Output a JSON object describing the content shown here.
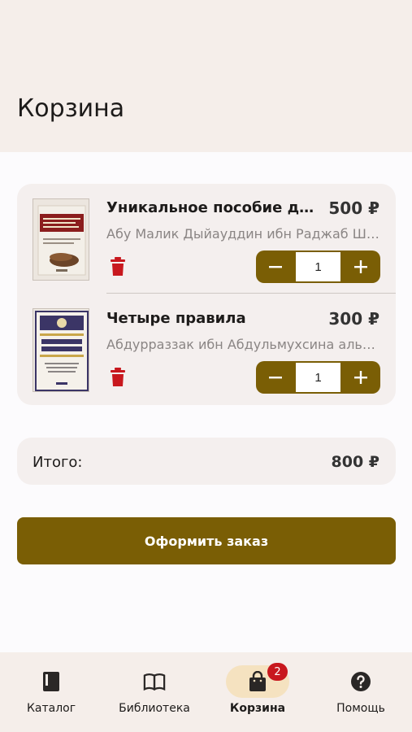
{
  "header": {
    "title": "Корзина"
  },
  "cart": {
    "items": [
      {
        "title": "Уникальное пособие для изучения Единобожия",
        "author": "Абу Малик Дыйауддин ибн Раджаб Шималов",
        "price": "500 ₽",
        "quantity": "1",
        "cover_color": "#5a3a2a"
      },
      {
        "title": "Четыре правила",
        "author": "Абдурраззак ибн Абдульмухсина аль-Бадр",
        "price": "300 ₽",
        "quantity": "1",
        "cover_color": "#3b3566"
      }
    ],
    "currency": "₽"
  },
  "total": {
    "label": "Итого:",
    "value": "800 ₽"
  },
  "checkout_label": "Оформить заказ",
  "nav": {
    "items": [
      {
        "label": "Каталог",
        "icon": "book-icon"
      },
      {
        "label": "Библиотека",
        "icon": "open-book-icon"
      },
      {
        "label": "Корзина",
        "icon": "shopping-bag-icon",
        "active": true
      },
      {
        "label": "Помощь",
        "icon": "help-icon"
      }
    ],
    "cart_badge": "2"
  },
  "colors": {
    "accent": "#7a5e05",
    "header_bg": "#f5eeea",
    "card_bg": "#f4efee",
    "delete": "#c8181e",
    "badge": "#c8181e",
    "active_pill": "#f5e2c0"
  }
}
